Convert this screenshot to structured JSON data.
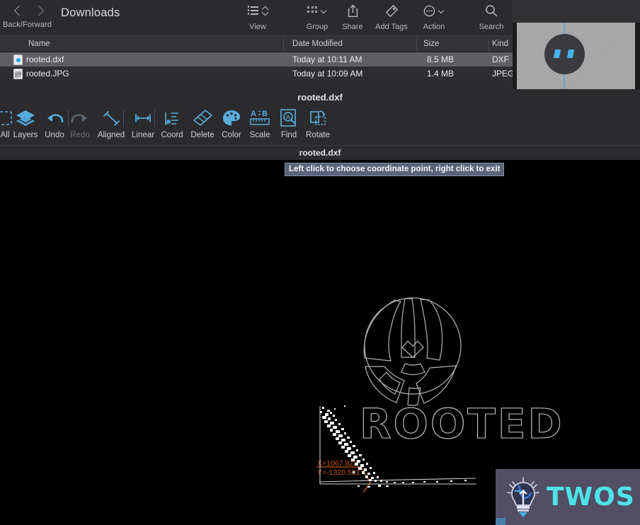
{
  "finder": {
    "title": "Downloads",
    "nav": {
      "back_forward_label": "Back/Forward",
      "back_icon": "chevron-left-icon",
      "forward_icon": "chevron-right-icon"
    },
    "toolbar": [
      {
        "label": "View",
        "icon": "list-view-icon"
      },
      {
        "label": "Group",
        "icon": "grid-group-icon"
      },
      {
        "label": "Share",
        "icon": "share-icon"
      },
      {
        "label": "Add Tags",
        "icon": "tag-icon"
      },
      {
        "label": "Action",
        "icon": "action-ellipsis-icon"
      },
      {
        "label": "Search",
        "icon": "search-icon"
      }
    ],
    "columns": [
      "Name",
      "Date Modified",
      "Size",
      "Kind"
    ],
    "rows": [
      {
        "name": "rooted.dxf",
        "date": "Today at 10:11 AM",
        "size": "8.5 MB",
        "kind": "DXF",
        "icon": "dxf-file-icon",
        "selected": true
      },
      {
        "name": "rooted.JPG",
        "date": "Today at 10:09 AM",
        "size": "1.4 MB",
        "kind": "JPEG",
        "icon": "jpeg-file-icon",
        "selected": false
      }
    ]
  },
  "editor": {
    "document_title": "rooted.dxf",
    "canvas_title": "rooted.dxf",
    "accent_color": "#5aaede",
    "toolbar": [
      {
        "label": "All",
        "icon": "select-all-icon",
        "enabled": true
      },
      {
        "label": "Layers",
        "icon": "layers-icon",
        "enabled": true
      },
      {
        "label": "Undo",
        "icon": "undo-arrow-icon",
        "enabled": true
      },
      {
        "label": "Redo",
        "icon": "redo-arrow-icon",
        "enabled": false
      },
      {
        "label": "Aligned",
        "icon": "aligned-dimension-icon",
        "enabled": true
      },
      {
        "label": "Linear",
        "icon": "linear-dimension-icon",
        "enabled": true
      },
      {
        "label": "Coord",
        "icon": "coordinate-icon",
        "enabled": true
      },
      {
        "label": "Delete",
        "icon": "eraser-icon",
        "enabled": true
      },
      {
        "label": "Color",
        "icon": "palette-icon",
        "enabled": true
      },
      {
        "label": "Scale",
        "icon": "scale-ruler-icon",
        "enabled": true
      },
      {
        "label": "Find",
        "icon": "find-magnifier-icon",
        "enabled": true
      },
      {
        "label": "Rotate",
        "icon": "rotate-icon",
        "enabled": true
      }
    ],
    "tooltip": "Left click to choose coordinate point, right click to exit",
    "annotation": {
      "x_label": "X=1067.822",
      "y_label": "Y=-1320.531",
      "color": "#c4541a"
    },
    "drawing": {
      "wordmark": "ROOTED",
      "emblem": "circular-segmented-emblem",
      "line_color": "#b4b4b4"
    }
  },
  "preview": {
    "indicator": "face-circle-indicator",
    "accent_color": "#5f86b8"
  },
  "watermark": {
    "text": "TWOS",
    "icon": "lightbulb-icon",
    "background_color": "#514e66",
    "text_color": "#4fe3e8"
  }
}
